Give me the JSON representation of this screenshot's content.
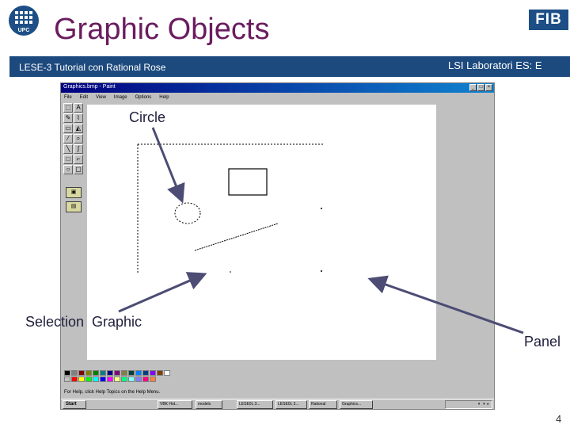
{
  "slide": {
    "title": "Graphic Objects",
    "subtitle_left": "LESE-3 Tutorial con Rational Rose",
    "subtitle_right": "LSI Laboratori ES: E",
    "page_number": "4",
    "brand_colors": {
      "title": "#6a1c5e",
      "band": "#1d4a7e",
      "logo": "#1d4f86"
    },
    "logos": {
      "left": "UPC",
      "right": "FIB"
    }
  },
  "labels": {
    "circle": "Circle",
    "selection": "Selection",
    "graphic": "Graphic",
    "panel": "Panel"
  },
  "app": {
    "menu": [
      "File",
      "Edit",
      "View",
      "Image",
      "Options",
      "Help"
    ],
    "window_buttons": [
      "_",
      "□",
      "×"
    ],
    "tools": [
      "select-icon",
      "text-icon",
      "pencil-icon",
      "brush-icon",
      "eraser-icon",
      "fill-icon",
      "picker-icon",
      "zoom-icon",
      "line-icon",
      "curve-icon",
      "rectangle-icon",
      "polygon-icon",
      "ellipse-icon",
      "rounded-rect-icon"
    ],
    "palette": [
      "#000000",
      "#808080",
      "#800000",
      "#808000",
      "#008000",
      "#008080",
      "#000080",
      "#800080",
      "#808040",
      "#004040",
      "#0080ff",
      "#004080",
      "#8000ff",
      "#804000",
      "#ffffff",
      "#c0c0c0",
      "#ff0000",
      "#ffff00",
      "#00ff00",
      "#00ffff",
      "#0000ff",
      "#ff00ff",
      "#ffff80",
      "#00ff80",
      "#80ffff",
      "#8080ff",
      "#ff0080",
      "#ff8040"
    ]
  }
}
